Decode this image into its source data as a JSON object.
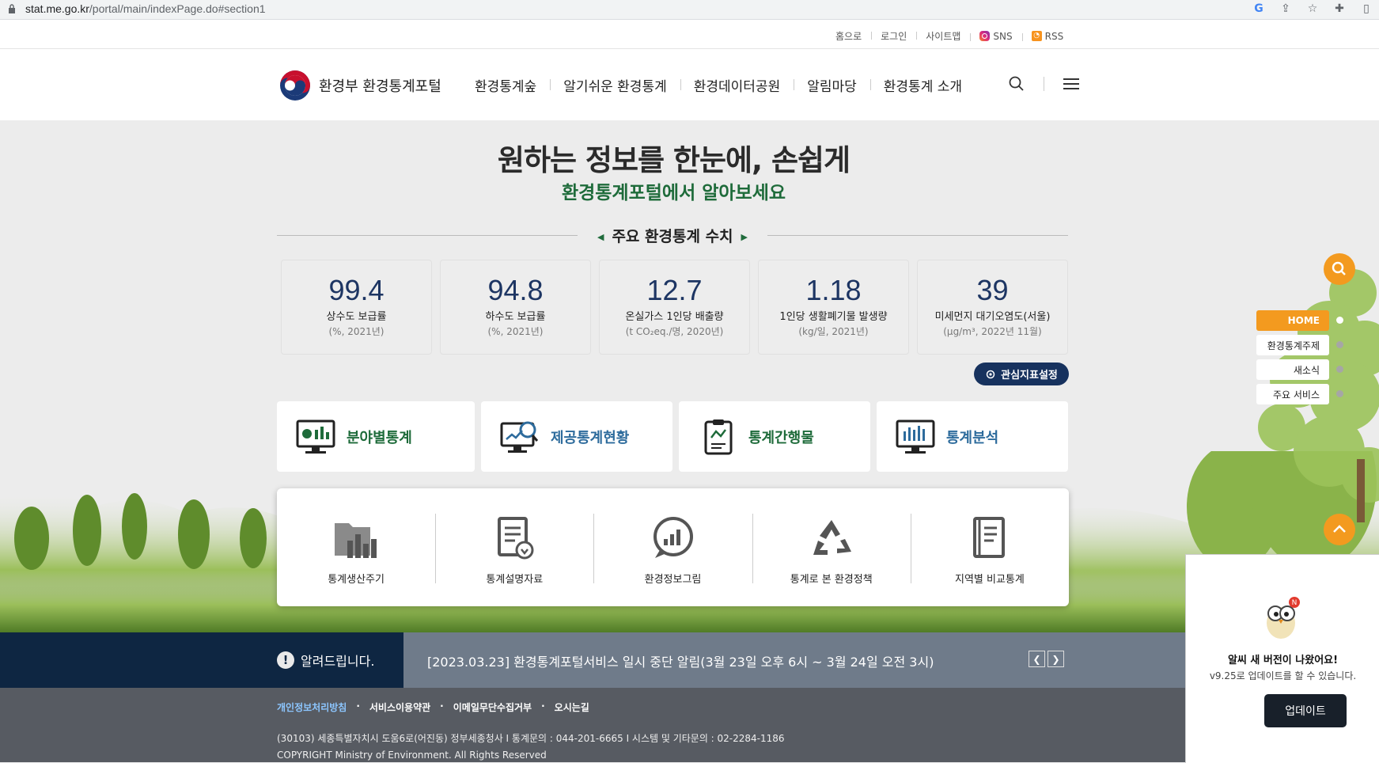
{
  "browser": {
    "url_host": "stat.me.go.kr",
    "url_path": "/portal/main/indexPage.do#section1"
  },
  "util_links": [
    "홈으로",
    "로그인",
    "사이트맵",
    "SNS",
    "RSS"
  ],
  "header": {
    "site_name": "환경부  환경통계포털",
    "nav": [
      "환경통계숲",
      "알기쉬운 환경통계",
      "환경데이터공원",
      "알림마당",
      "환경통계 소개"
    ]
  },
  "hero": {
    "title": "원하는 정보를 한눈에, 손쉽게",
    "subtitle": "환경통계포털에서 알아보세요"
  },
  "stats_section": {
    "title": "주요 환경통계 수치",
    "items": [
      {
        "value": "99.4",
        "label": "상수도 보급률",
        "unit": "(%, 2021년)"
      },
      {
        "value": "94.8",
        "label": "하수도 보급률",
        "unit": "(%, 2021년)"
      },
      {
        "value": "12.7",
        "label": "온실가스 1인당 배출량",
        "unit": "(t CO₂eq./명, 2020년)"
      },
      {
        "value": "1.18",
        "label": "1인당 생활폐기물 발생량",
        "unit": "(kg/일, 2021년)"
      },
      {
        "value": "39",
        "label": "미세먼지 대기오염도(서울)",
        "unit": "(μg/m³, 2022년 11월)"
      }
    ],
    "button": "관심지표설정"
  },
  "cards": [
    {
      "label": "분야별통계",
      "color": "#1e6b3a"
    },
    {
      "label": "제공통계현황",
      "color": "#2d6b9c"
    },
    {
      "label": "통계간행물",
      "color": "#1e6b3a"
    },
    {
      "label": "통계분석",
      "color": "#2d6b9c"
    }
  ],
  "panel_items": [
    "통계생산주기",
    "통계설명자료",
    "환경정보그림",
    "통계로 본 환경정책",
    "지역별 비교통계"
  ],
  "notice": {
    "label": "알려드립니다.",
    "message": "[2023.03.23] 환경통계포털서비스 일시 중단 알림(3월 23일 오후 6시 ~ 3월 24일 오전 3시)"
  },
  "footer": {
    "links": [
      "개인정보처리방침",
      "서비스이용약관",
      "이메일무단수집거부",
      "오시는길"
    ],
    "address": "(30103) 세종특별자치시 도움6로(어진동) 정부세종청사 I 통계문의 : 044-201-6665 I 시스템 및 기타문의 : 02-2284-1186",
    "copyright": "COPYRIGHT Ministry of Environment. All Rights Reserved"
  },
  "quick_menu": [
    "HOME",
    "환경통계주제",
    "새소식",
    "주요 서비스"
  ],
  "popup": {
    "title": "알씨 새 버전이 나왔어요!",
    "desc": "v9.25로 업데이트를 할 수 있습니다.",
    "button": "업데이트",
    "badge": "N"
  },
  "colors": {
    "navy": "#17325e",
    "green": "#1e6b3a",
    "orange": "#f39a1f"
  }
}
